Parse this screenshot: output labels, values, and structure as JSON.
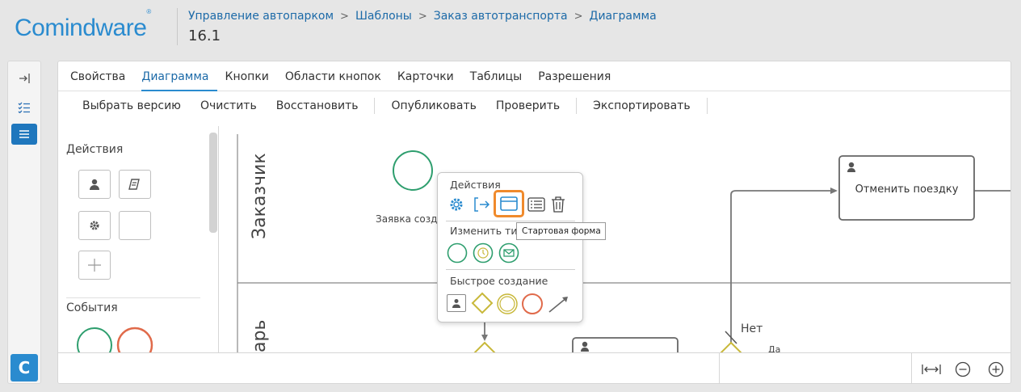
{
  "header": {
    "logo_text": "Comindware",
    "logo_mark": "®",
    "breadcrumb": [
      "Управление автопарком",
      "Шаблоны",
      "Заказ автотранспорта",
      "Диаграмма"
    ],
    "breadcrumb_separator": ">",
    "version": "16.1"
  },
  "tabs": [
    {
      "label": "Свойства",
      "active": false
    },
    {
      "label": "Диаграмма",
      "active": true
    },
    {
      "label": "Кнопки",
      "active": false
    },
    {
      "label": "Области кнопок",
      "active": false
    },
    {
      "label": "Карточки",
      "active": false
    },
    {
      "label": "Таблицы",
      "active": false
    },
    {
      "label": "Разрешения",
      "active": false
    }
  ],
  "toolbar": {
    "select_version": "Выбрать версию",
    "clear": "Очистить",
    "restore": "Восстановить",
    "publish": "Опубликовать",
    "validate": "Проверить",
    "export": "Экспортировать"
  },
  "palette": {
    "actions_title": "Действия",
    "events_title": "События"
  },
  "diagram": {
    "lane1": "Заказчик",
    "lane2": "арь",
    "start_event_label": "Заявка созд",
    "task_cancel": "Отменить поездку",
    "gateway_no_label": "Нет",
    "partial_label": "Да"
  },
  "popup": {
    "actions_title": "Действия",
    "change_type_title": "Изменить ти",
    "quick_create_title": "Быстрое создание",
    "tooltip": "Стартовая форма"
  },
  "colors": {
    "accent": "#2a8bcf",
    "start_event": "#2e9e6e",
    "end_event": "#e06a4a",
    "gateway": "#c8b83a",
    "highlight": "#f08a2c"
  }
}
